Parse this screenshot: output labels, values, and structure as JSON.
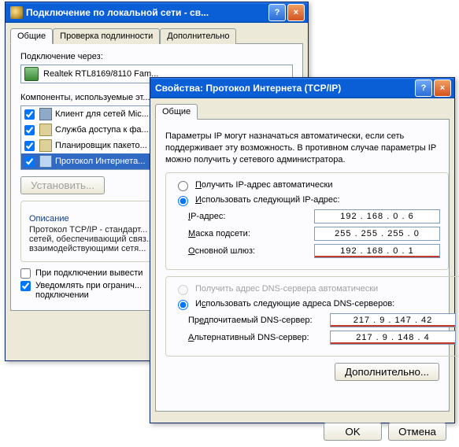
{
  "win1": {
    "title": "Подключение по локальной сети - св...",
    "tabs": [
      "Общие",
      "Проверка подлинности",
      "Дополнительно"
    ],
    "connect_via_label": "Подключение через:",
    "adapter": "Realtek RTL8169/8110 Fam...",
    "components_label": "Компоненты, используемые эт...",
    "components": [
      {
        "name": "Клиент для сетей Mic...",
        "checked": true
      },
      {
        "name": "Служба доступа к фа...",
        "checked": true
      },
      {
        "name": "Планировщик пакето...",
        "checked": true
      },
      {
        "name": "Протокол Интернета...",
        "checked": true
      }
    ],
    "btn_install": "Установить...",
    "desc_title": "Описание",
    "desc_text": "Протокол TCP/IP - стандарт...\nсетей, обеспечивающий связ...\nвзаимодействующими сетя...",
    "check_show_icon": "При подключении вывести",
    "check_notify": "Уведомлять при огранич...\nподключении"
  },
  "win2": {
    "title": "Свойства: Протокол Интернета (TCP/IP)",
    "tab": "Общие",
    "info": "Параметры IP могут назначаться автоматически, если сеть поддерживает эту возможность. В противном случае параметры IP можно получить у сетевого администратора.",
    "radio_auto_ip": "Получить IP-адрес автоматически",
    "radio_manual_ip": "Использовать следующий IP-адрес:",
    "ip_label": "IP-адрес:",
    "ip_value": "192 . 168 .  0  .  6",
    "mask_label": "Маска подсети:",
    "mask_value": "255 . 255 . 255 .  0",
    "gw_label": "Основной шлюз:",
    "gw_value": "192 . 168 .  0  .  1",
    "radio_auto_dns": "Получить адрес DNS-сервера автоматически",
    "radio_manual_dns": "Использовать следующие адреса DNS-серверов:",
    "dns1_label": "Предпочитаемый DNS-сервер:",
    "dns1_value": "217 .  9  . 147 . 42",
    "dns2_label": "Альтернативный DNS-сервер:",
    "dns2_value": "217 .  9  . 148 .  4",
    "btn_advanced": "Дополнительно...",
    "btn_ok": "OK",
    "btn_cancel": "Отмена"
  }
}
